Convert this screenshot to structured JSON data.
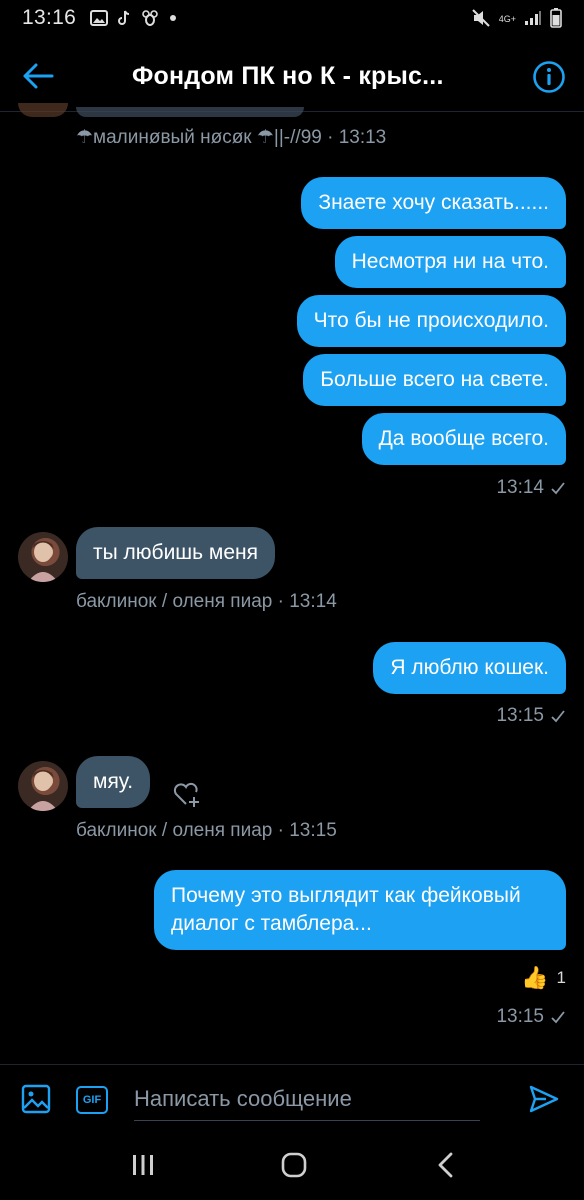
{
  "status_bar": {
    "time": "13:16",
    "network_label": "4G+",
    "icons_left": [
      "image-icon",
      "tiktok-icon",
      "bee-icon",
      "dot-icon"
    ],
    "icons_right": [
      "mute-icon",
      "network-icon",
      "signal-icon",
      "battery-icon"
    ]
  },
  "header": {
    "title": "Фондом ПК но К - крыс...",
    "back_icon": "back-arrow-icon",
    "info_icon": "info-icon",
    "accent_color": "#1da1f2"
  },
  "messages": {
    "top_meta": "☂малинøвый нøсøк ☂||-//99 · 13:13",
    "outgoing_group_1": [
      "Знаете хочу сказать......",
      "Несмотря ни на что.",
      "Что бы не происходило.",
      "Больше всего на свете.",
      "Да вообще всего."
    ],
    "outgoing_group_1_time": "13:14",
    "incoming_1": {
      "text": "ты любишь меня",
      "meta": "баклинок / оленя пиар · 13:14"
    },
    "outgoing_2": {
      "text": "Я люблю кошек.",
      "time": "13:15"
    },
    "incoming_2": {
      "text": "мяу.",
      "meta": "баклинок / оленя пиар · 13:15"
    },
    "outgoing_3": {
      "text": "Почему это выглядит как фейковый диалог с тамблера...",
      "reaction_emoji": "👍",
      "reaction_count": "1",
      "time": "13:15"
    }
  },
  "composer": {
    "placeholder": "Написать сообщение",
    "gif_label": "GIF",
    "media_icon": "image-icon",
    "send_icon": "send-icon"
  },
  "colors": {
    "outgoing_bubble": "#1da1f2",
    "incoming_bubble": "#3d5466",
    "meta_text": "#8b98a5",
    "background": "#000000"
  }
}
